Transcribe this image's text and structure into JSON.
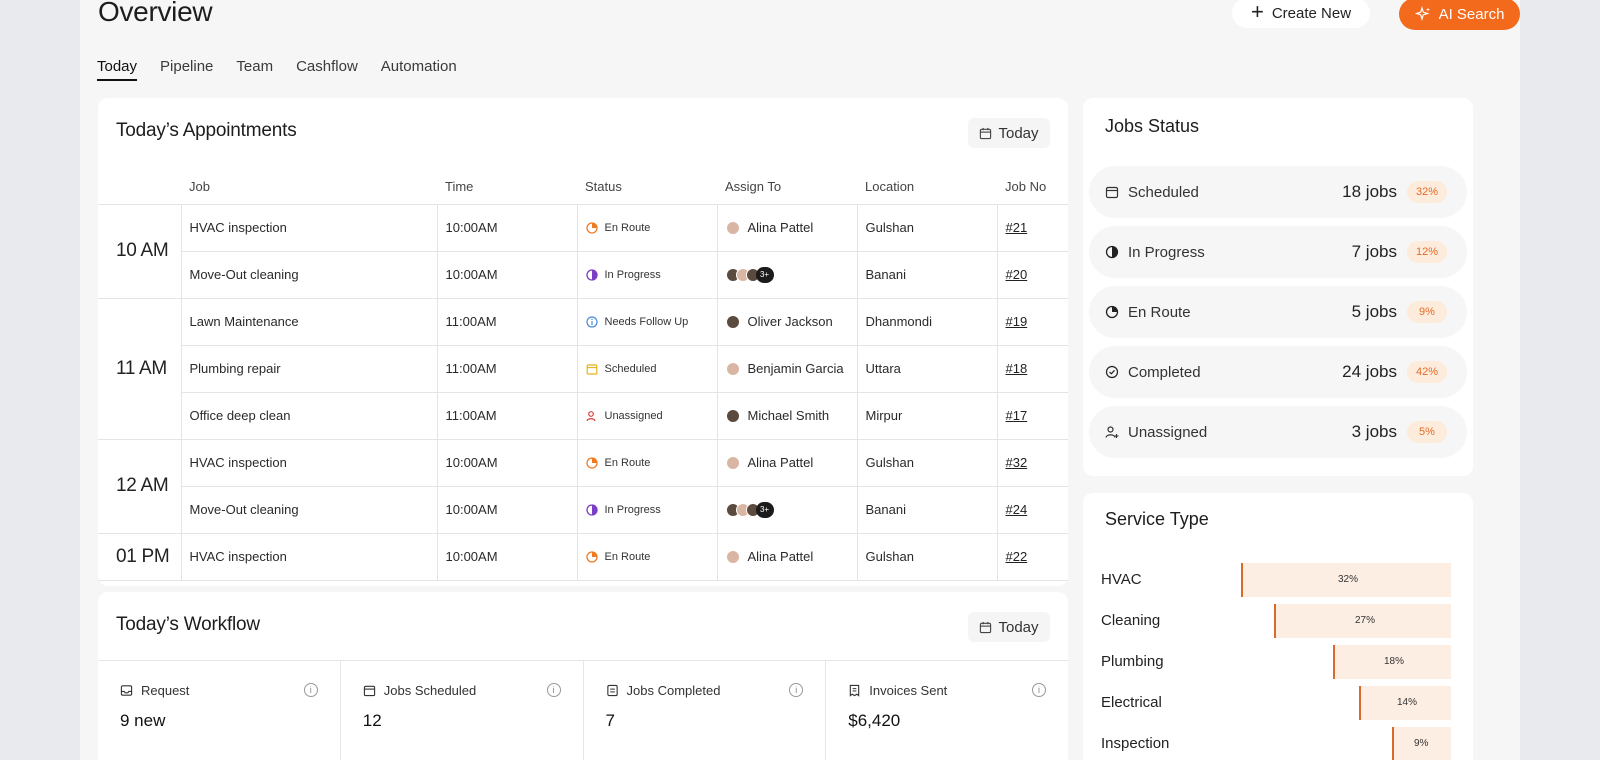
{
  "header": {
    "title": "Overview",
    "create_label": "Create New",
    "ai_label": "AI Search"
  },
  "tabs": [
    "Today",
    "Pipeline",
    "Team",
    "Cashflow",
    "Automation"
  ],
  "appointments": {
    "title": "Today’s Appointments",
    "filter_label": "Today",
    "columns": [
      "Job",
      "Time",
      "Status",
      "Assign To",
      "Location",
      "Job No"
    ],
    "groups": [
      {
        "time": "10 AM",
        "rows": [
          {
            "job": "HVAC inspection",
            "time": "10:00AM",
            "status": "En Route",
            "assign": "Alina Pattel",
            "location": "Gulshan",
            "job_no": "#21"
          },
          {
            "job": "Move-Out cleaning",
            "time": "10:00AM",
            "status": "In Progress",
            "assign": "3+",
            "location": "Banani",
            "job_no": "#20"
          }
        ]
      },
      {
        "time": "11 AM",
        "rows": [
          {
            "job": "Lawn Maintenance",
            "time": "11:00AM",
            "status": "Needs Follow Up",
            "assign": "Oliver Jackson",
            "location": "Dhanmondi",
            "job_no": "#19"
          },
          {
            "job": "Plumbing repair",
            "time": "11:00AM",
            "status": "Scheduled",
            "assign": "Benjamin Garcia",
            "location": "Uttara",
            "job_no": "#18"
          },
          {
            "job": "Office deep clean",
            "time": "11:00AM",
            "status": "Unassigned",
            "assign": "Michael Smith",
            "location": "Mirpur",
            "job_no": "#17"
          }
        ]
      },
      {
        "time": "12 AM",
        "rows": [
          {
            "job": "HVAC inspection",
            "time": "10:00AM",
            "status": "En Route",
            "assign": "Alina Pattel",
            "location": "Gulshan",
            "job_no": "#32"
          },
          {
            "job": "Move-Out cleaning",
            "time": "10:00AM",
            "status": "In Progress",
            "assign": "3+",
            "location": "Banani",
            "job_no": "#24"
          }
        ]
      },
      {
        "time": "01 PM",
        "rows": [
          {
            "job": "HVAC inspection",
            "time": "10:00AM",
            "status": "En Route",
            "assign": "Alina Pattel",
            "location": "Gulshan",
            "job_no": "#22"
          }
        ]
      }
    ]
  },
  "workflow": {
    "title": "Today’s Workflow",
    "filter_label": "Today",
    "cells": [
      {
        "label": "Request",
        "value": "9 new",
        "icon": "inbox-icon"
      },
      {
        "label": "Jobs Scheduled",
        "value": "12",
        "icon": "calendar-icon"
      },
      {
        "label": "Jobs Completed",
        "value": "7",
        "icon": "document-icon"
      },
      {
        "label": "Invoices Sent",
        "value": "$6,420",
        "icon": "invoice-icon"
      }
    ],
    "info_glyph": "i"
  },
  "jobs_status": {
    "title": "Jobs Status",
    "rows": [
      {
        "label": "Scheduled",
        "count": "18 jobs",
        "pct": "32%",
        "icon": "calendar-icon"
      },
      {
        "label": "In Progress",
        "count": "7 jobs",
        "pct": "12%",
        "icon": "half-circle-icon"
      },
      {
        "label": "En Route",
        "count": "5 jobs",
        "pct": "9%",
        "icon": "pie-icon"
      },
      {
        "label": "Completed",
        "count": "24 jobs",
        "pct": "42%",
        "icon": "check-circle-icon"
      },
      {
        "label": "Unassigned",
        "count": "3 jobs",
        "pct": "5%",
        "icon": "user-plus-icon"
      }
    ]
  },
  "service_type": {
    "title": "Service Type",
    "rows": [
      {
        "label": "HVAC",
        "pct_label": "32%",
        "value": 32
      },
      {
        "label": "Cleaning",
        "pct_label": "27%",
        "value": 27
      },
      {
        "label": "Plumbing",
        "pct_label": "18%",
        "value": 18
      },
      {
        "label": "Electrical",
        "pct_label": "14%",
        "value": 14
      },
      {
        "label": "Inspection",
        "pct_label": "9%",
        "value": 9
      }
    ]
  },
  "colors": {
    "accent": "#f46a1d",
    "en_route": "#f07a22",
    "in_progress": "#7a3fc4",
    "follow_up": "#4a8ad8",
    "scheduled": "#e8b417",
    "unassigned": "#d9403a",
    "badge_bg": "#fdebdc"
  }
}
